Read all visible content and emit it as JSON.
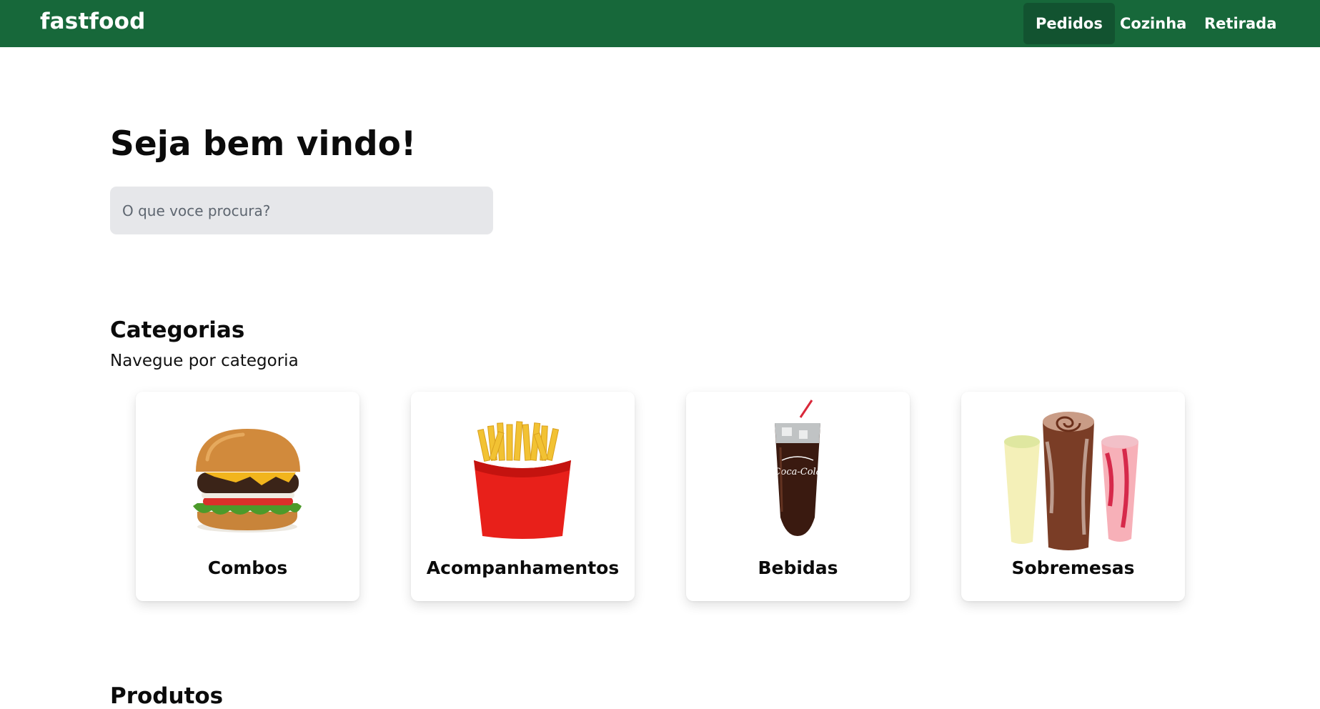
{
  "navbar": {
    "brand": "fastfood",
    "items": [
      {
        "label": "Pedidos",
        "active": true
      },
      {
        "label": "Cozinha",
        "active": false
      },
      {
        "label": "Retirada",
        "active": false
      }
    ],
    "color": "#17683a"
  },
  "welcome": {
    "title": "Seja bem vindo!",
    "search_placeholder": "O que voce procura?",
    "search_value": ""
  },
  "categories": {
    "title": "Categorias",
    "subtitle": "Navegue por categoria",
    "items": [
      {
        "label": "Combos",
        "icon": "burger-icon"
      },
      {
        "label": "Acompanhamentos",
        "icon": "fries-icon"
      },
      {
        "label": "Bebidas",
        "icon": "soda-cup-icon",
        "logo_text": "Coca-Cola"
      },
      {
        "label": "Sobremesas",
        "icon": "milkshake-icon"
      }
    ]
  },
  "next_section": {
    "title": "Produtos"
  }
}
